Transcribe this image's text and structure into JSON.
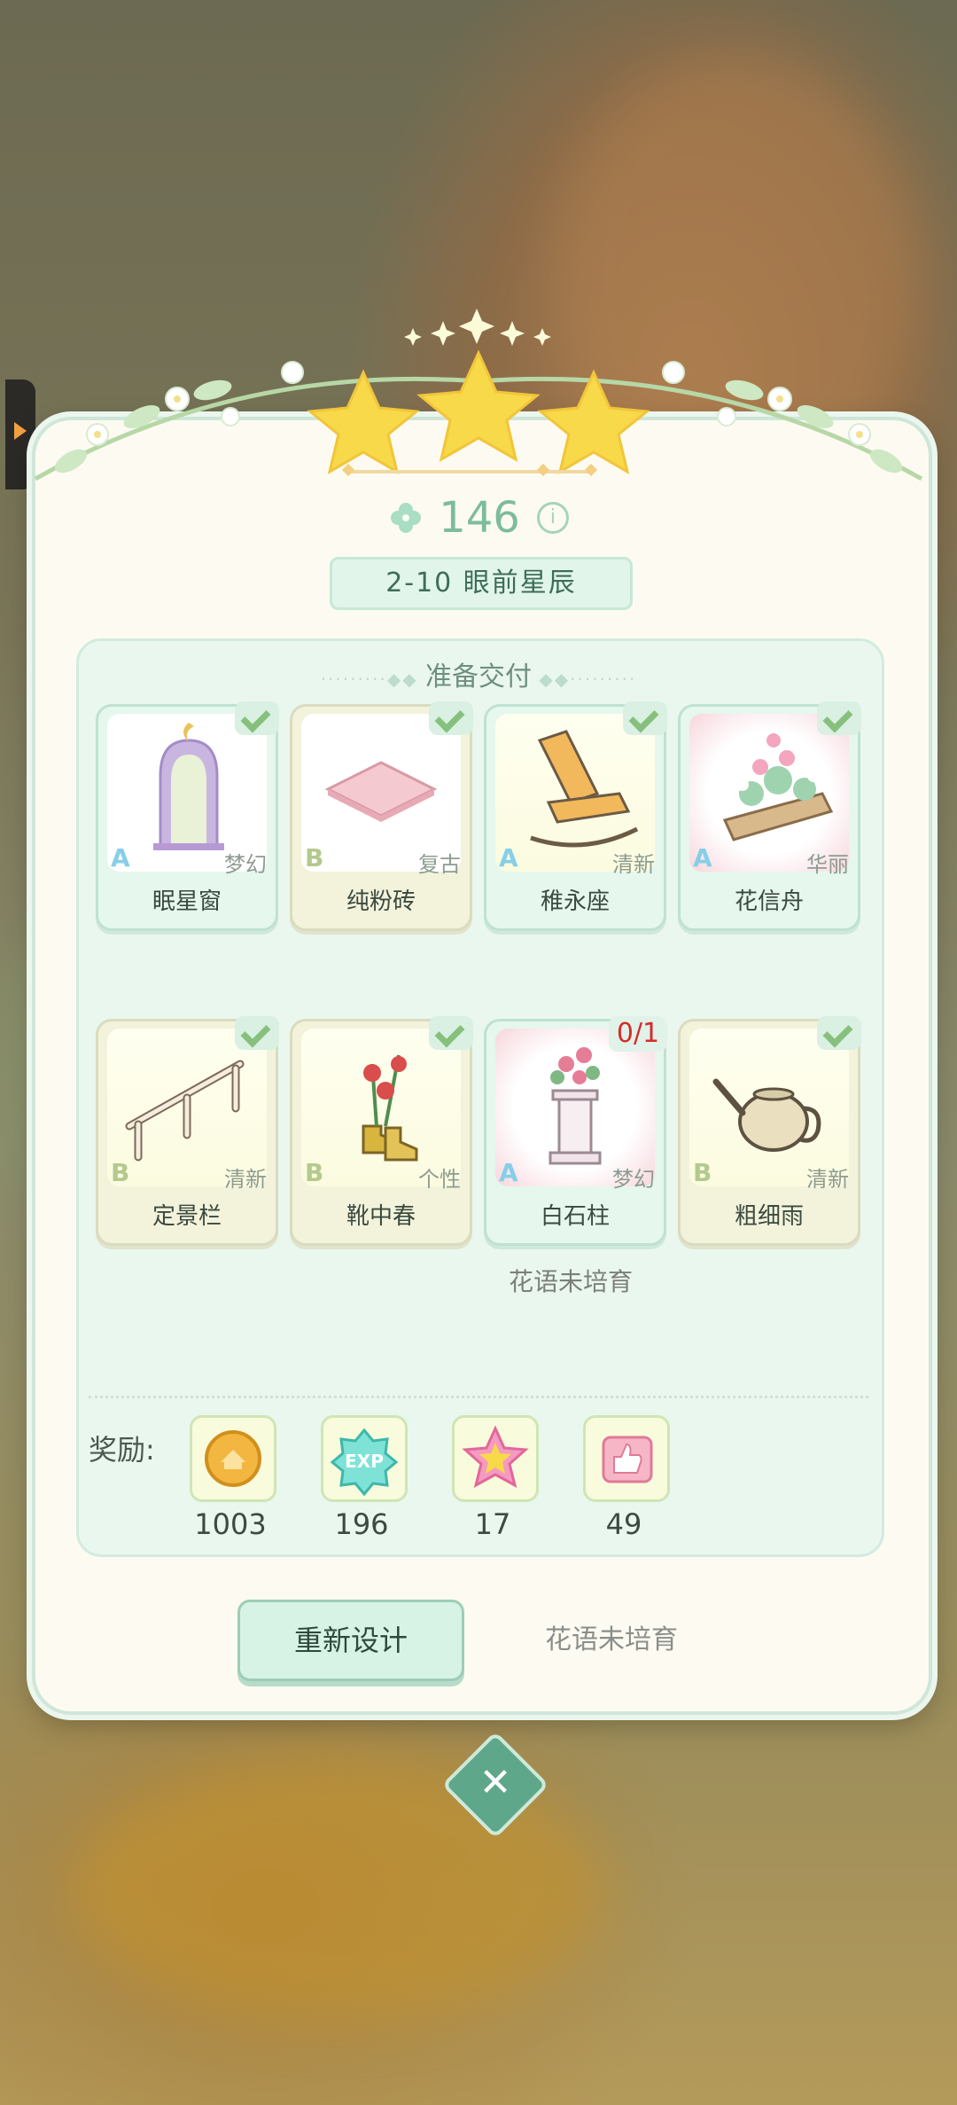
{
  "level": {
    "score": "146",
    "title": "2-10  眼前星辰"
  },
  "panel": {
    "title": "准备交付"
  },
  "items": [
    {
      "name": "眠星窗",
      "grade": "A",
      "style": "梦幻",
      "status": "done"
    },
    {
      "name": "纯粉砖",
      "grade": "B",
      "style": "复古",
      "status": "done"
    },
    {
      "name": "稚永座",
      "grade": "A",
      "style": "清新",
      "status": "done"
    },
    {
      "name": "花信舟",
      "grade": "A",
      "style": "华丽",
      "status": "done"
    },
    {
      "name": "定景栏",
      "grade": "B",
      "style": "清新",
      "status": "done"
    },
    {
      "name": "靴中春",
      "grade": "B",
      "style": "个性",
      "status": "done"
    },
    {
      "name": "白石柱",
      "grade": "A",
      "style": "梦幻",
      "status": "pending",
      "count": "0/1",
      "note": "花语未培育"
    },
    {
      "name": "粗细雨",
      "grade": "B",
      "style": "清新",
      "status": "done"
    }
  ],
  "rewards": {
    "label": "奖励:",
    "list": [
      {
        "icon": "coin-icon",
        "value": "1003"
      },
      {
        "icon": "exp-icon",
        "value": "196"
      },
      {
        "icon": "star-icon",
        "value": "17"
      },
      {
        "icon": "thumbs-up-icon",
        "value": "49"
      }
    ]
  },
  "buttons": {
    "redesign": "重新设计",
    "disabled_label": "花语未培育",
    "close": "✕"
  },
  "colors": {
    "accent": "#7cbc9c",
    "panel_bg": "#eaf7ef",
    "star": "#f7d94a",
    "count_red": "#d62b2b"
  }
}
